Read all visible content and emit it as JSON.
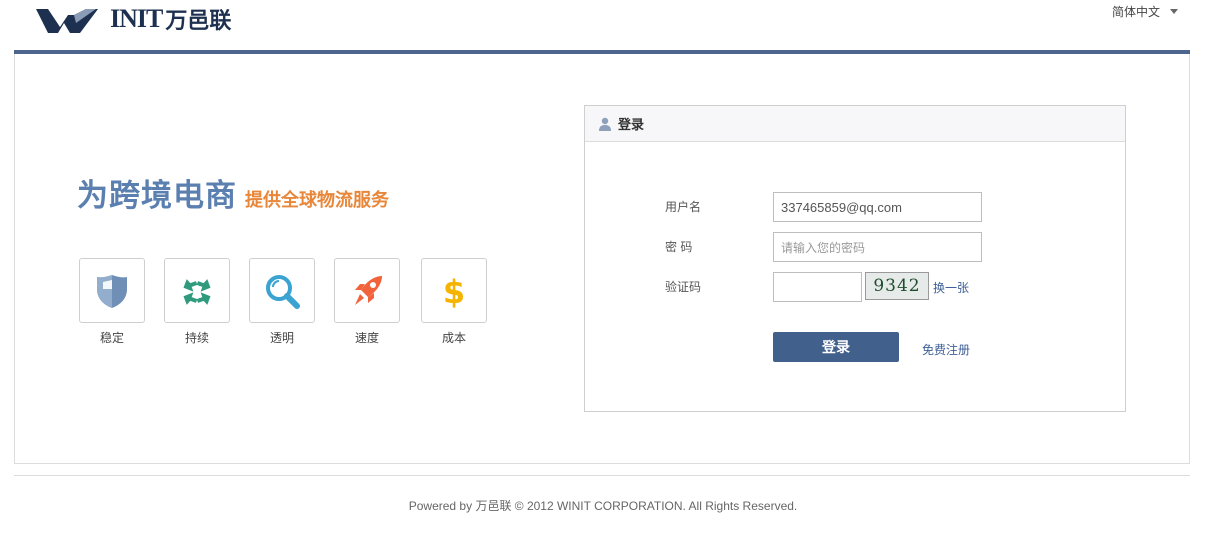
{
  "header": {
    "logo_text": "INIT",
    "logo_cn": "万邑联",
    "language": "简体中文"
  },
  "slogan": {
    "main": "为跨境电商",
    "sub": "提供全球物流服务"
  },
  "features": [
    {
      "label": "稳定",
      "icon": "shield-icon"
    },
    {
      "label": "持续",
      "icon": "arrows-icon"
    },
    {
      "label": "透明",
      "icon": "magnifier-icon"
    },
    {
      "label": "速度",
      "icon": "rocket-icon"
    },
    {
      "label": "成本",
      "icon": "dollar-icon"
    }
  ],
  "login": {
    "title": "登录",
    "username_label": "用户名",
    "username_value": "337465859@qq.com",
    "password_label": "密 码",
    "password_placeholder": "请输入您的密码",
    "captcha_label": "验证码",
    "captcha_value": "",
    "captcha_text": "9342",
    "captcha_refresh": "换一张",
    "submit": "登录",
    "register": "免费注册"
  },
  "colors": {
    "brand": "#41608c",
    "slogan_main": "#5b80b0",
    "slogan_sub": "#e8873a"
  },
  "footer": {
    "text": "Powered by 万邑联 © 2012 WINIT CORPORATION. All Rights Reserved."
  }
}
